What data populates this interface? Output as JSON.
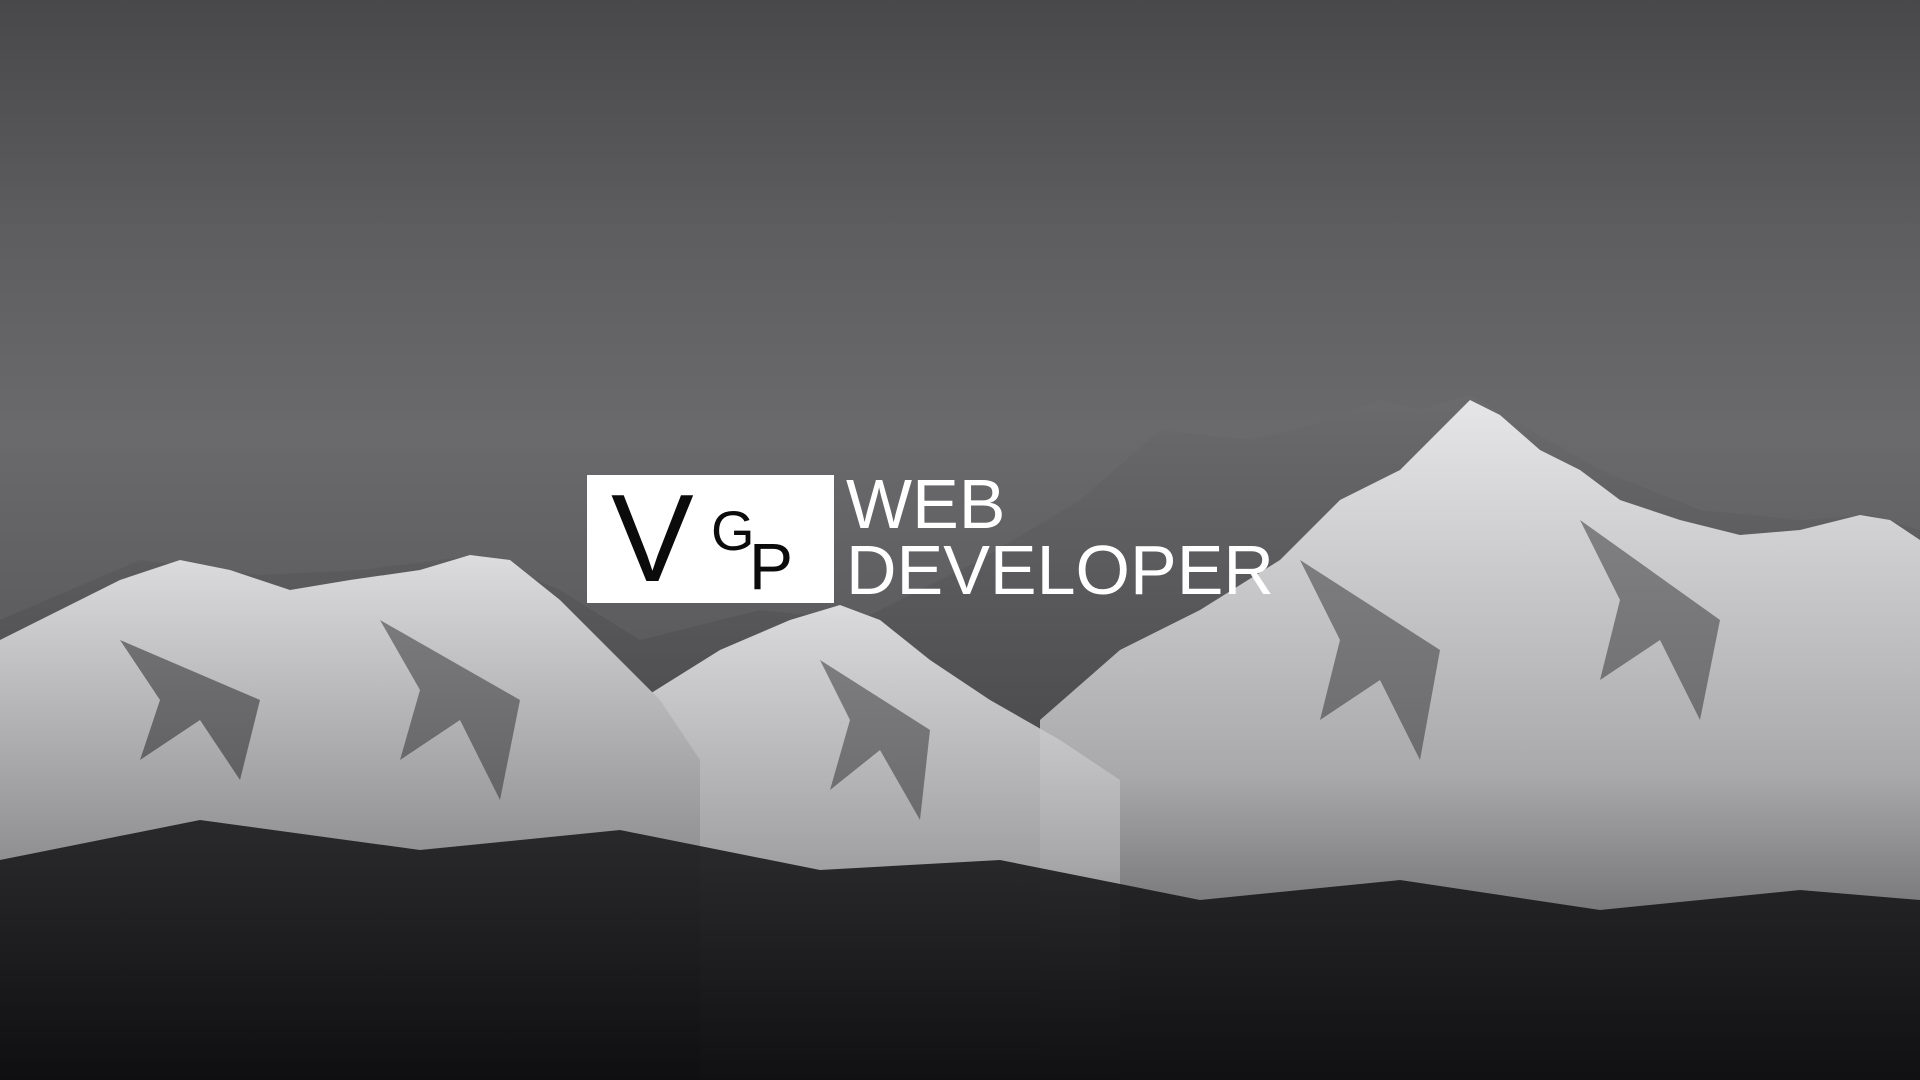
{
  "logo": {
    "letter_v": "V",
    "letter_g": "G",
    "letter_p": "P",
    "line1": "WEB",
    "line2": "DEVELOPER"
  },
  "background": {
    "subject": "snow-mountain-range",
    "palette": [
      "#5e5e60",
      "#d9d9d9",
      "#141416"
    ]
  }
}
